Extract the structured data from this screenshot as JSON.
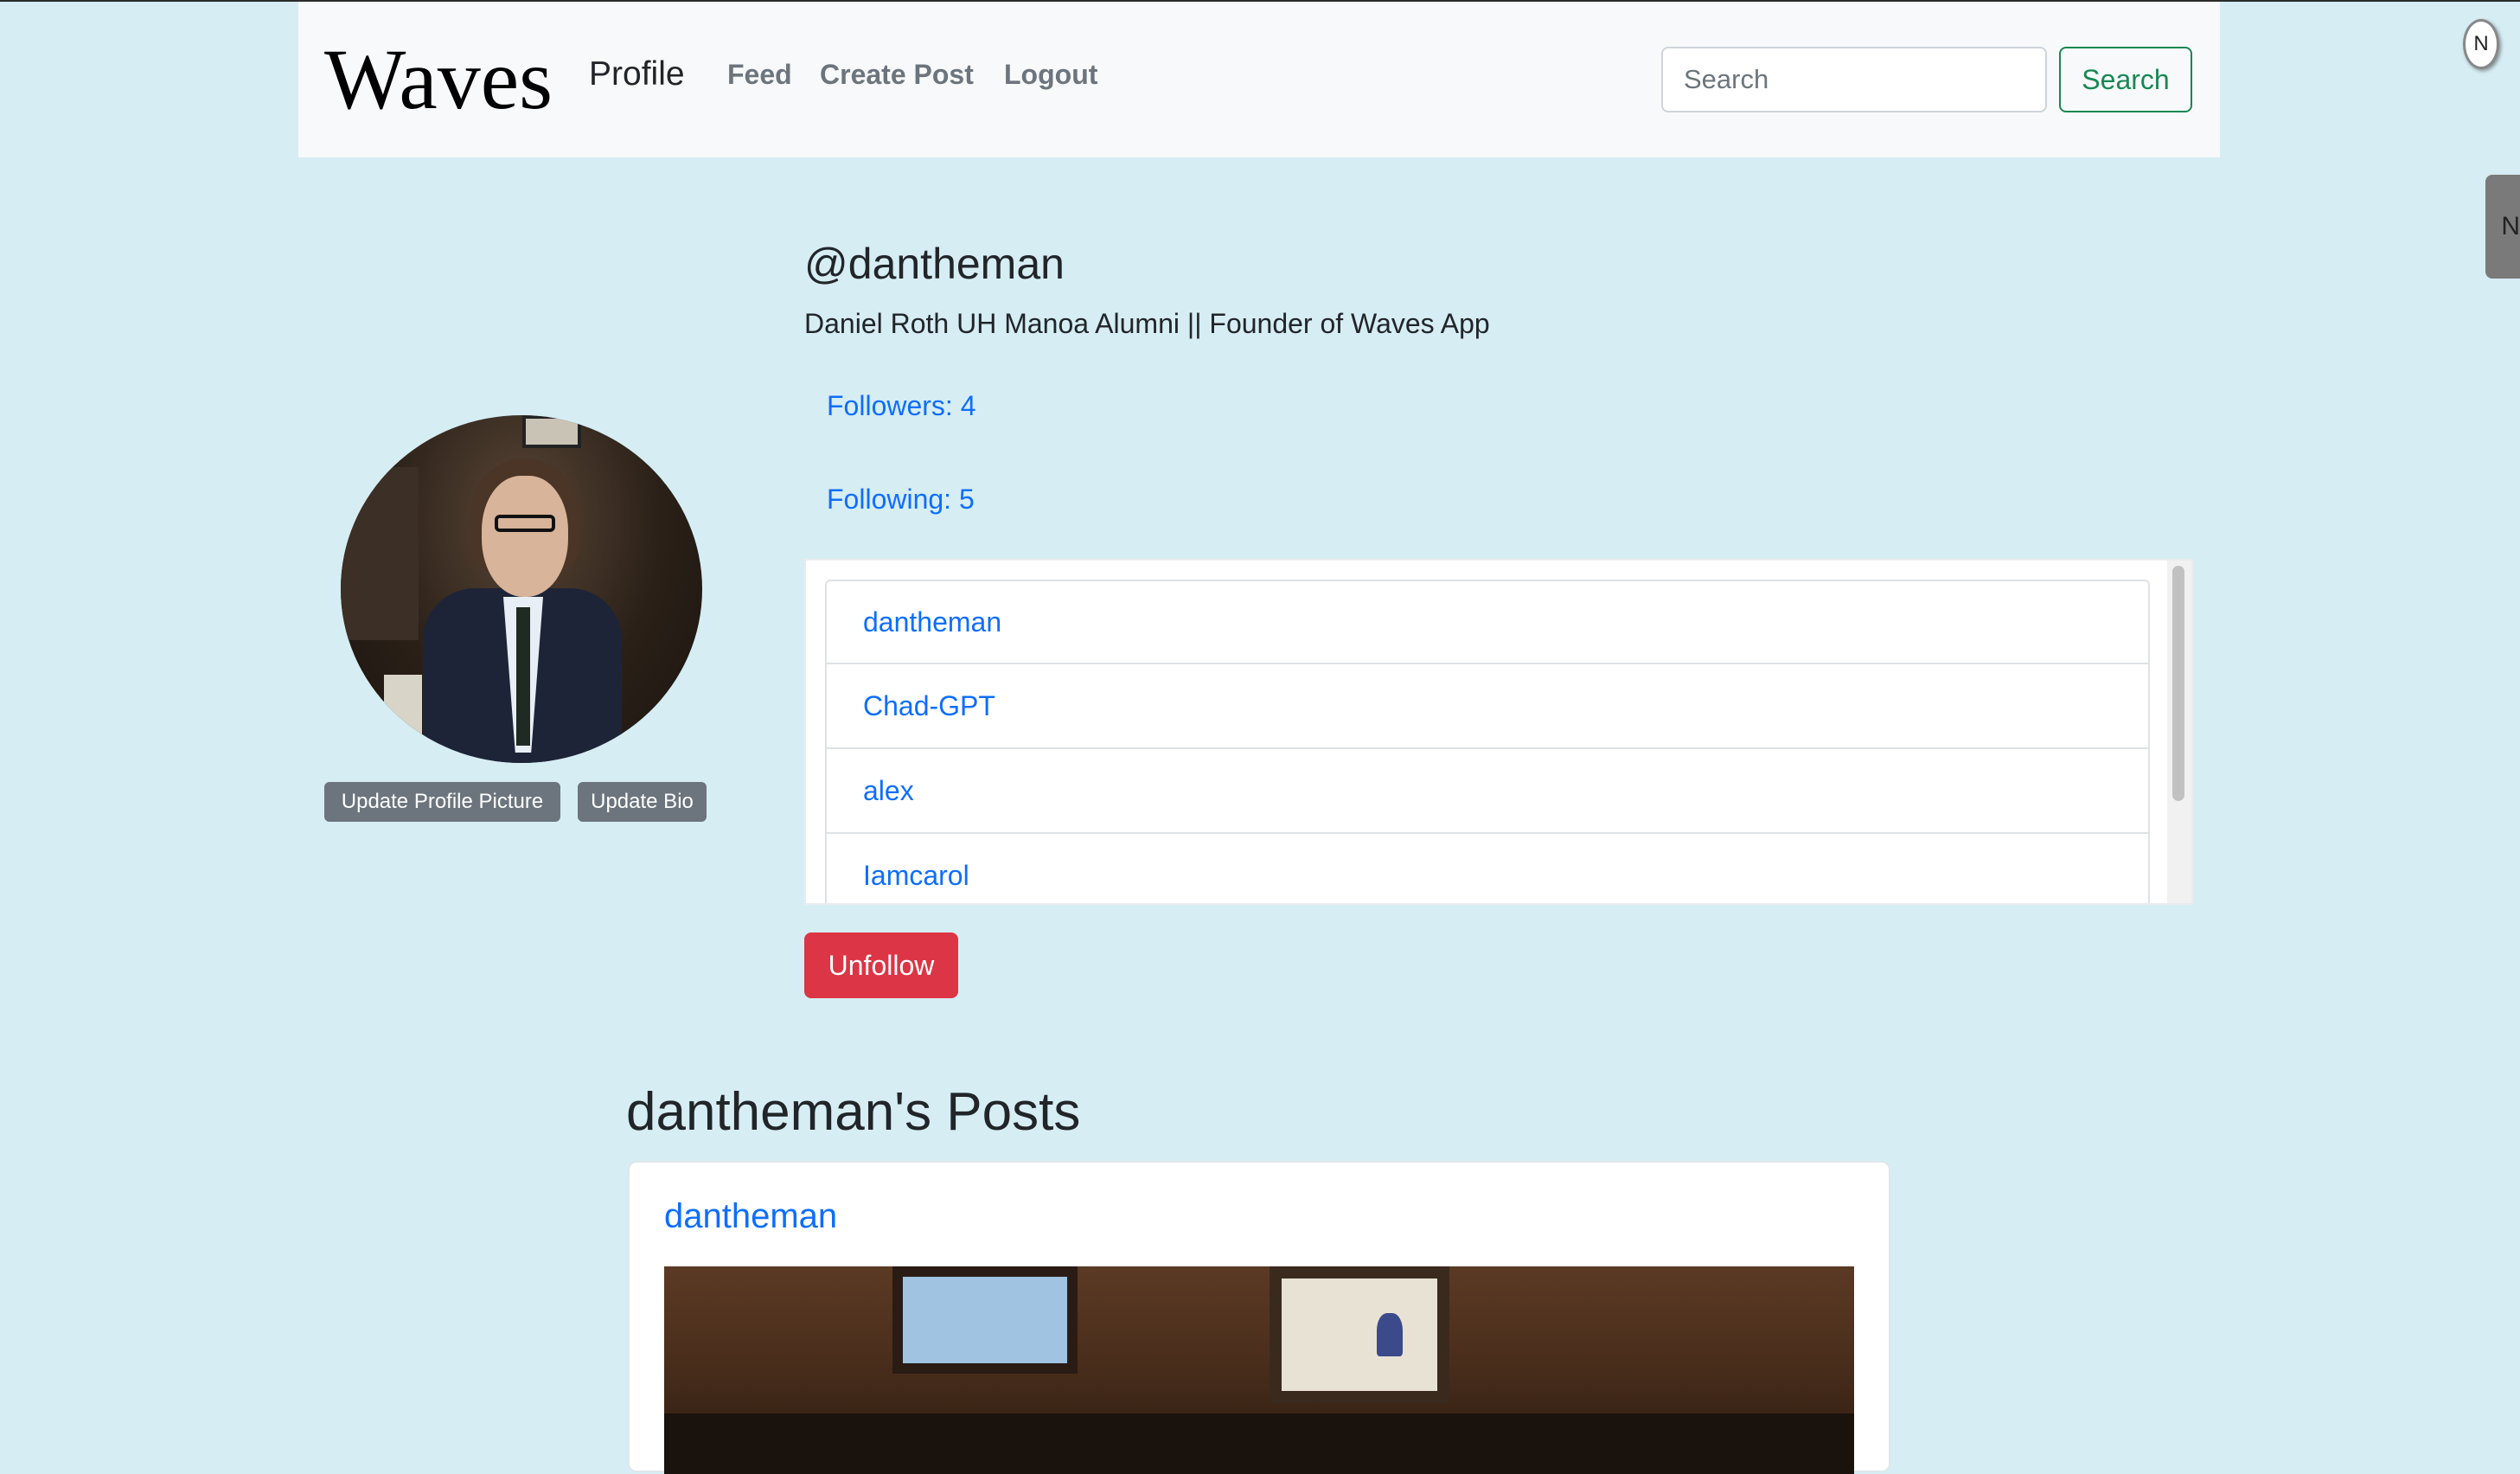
{
  "navbar": {
    "brand": "Waves",
    "active": "Profile",
    "links": [
      "Feed",
      "Create Post",
      "Logout"
    ],
    "search_placeholder": "Search",
    "search_button": "Search"
  },
  "extension": {
    "badge_letter": "N",
    "tab_letter": "N"
  },
  "profile": {
    "username": "@dantheman",
    "bio": "Daniel Roth UH Manoa Alumni || Founder of Waves App",
    "followers": "Followers: 4",
    "following": "Following: 5",
    "update_picture_label": "Update Profile Picture",
    "update_bio_label": "Update Bio",
    "list": [
      "dantheman",
      "Chad-GPT",
      "alex",
      "Iamcarol"
    ],
    "unfollow_label": "Unfollow"
  },
  "posts": {
    "heading": "dantheman's Posts",
    "items": [
      {
        "author": "dantheman"
      }
    ]
  },
  "colors": {
    "page_bg": "#d6edf4",
    "link": "#0d6efd",
    "success": "#198754",
    "danger": "#dc3545",
    "secondary": "#6c757d"
  }
}
